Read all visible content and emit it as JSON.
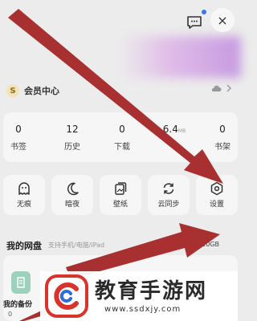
{
  "header": {
    "message_icon": "message-icon",
    "close_icon": "close-icon",
    "close_glyph": "×"
  },
  "vip": {
    "badge": "S",
    "label": "会员中心"
  },
  "stats": [
    {
      "value": "0",
      "unit": "",
      "label": "书签"
    },
    {
      "value": "12",
      "unit": "",
      "label": "历史"
    },
    {
      "value": "0",
      "unit": "",
      "label": "下载"
    },
    {
      "value": "6.4",
      "unit": "MB",
      "label": ""
    },
    {
      "value": "0",
      "unit": "",
      "label": "书架"
    }
  ],
  "tools": [
    {
      "icon": "ghost-icon",
      "label": "无痕"
    },
    {
      "icon": "moon-icon",
      "label": "暗夜"
    },
    {
      "icon": "wallpaper-icon",
      "label": "壁纸"
    },
    {
      "icon": "sync-icon",
      "label": "云同步"
    },
    {
      "icon": "settings-icon",
      "label": "设置"
    }
  ],
  "disk": {
    "title": "我的网盘",
    "subtitle": "支持手机/电脑/iPad",
    "storage": "6.4GB/10GB",
    "backup_label": "我的备份",
    "backup_count": "0"
  },
  "watermark": {
    "title": "教育手游网",
    "url": "www.ssdxjy.com"
  },
  "colors": {
    "background": "#ececec",
    "card": "#f6f6f6",
    "arrow": "#a83030",
    "accent": "#3b74f0"
  }
}
